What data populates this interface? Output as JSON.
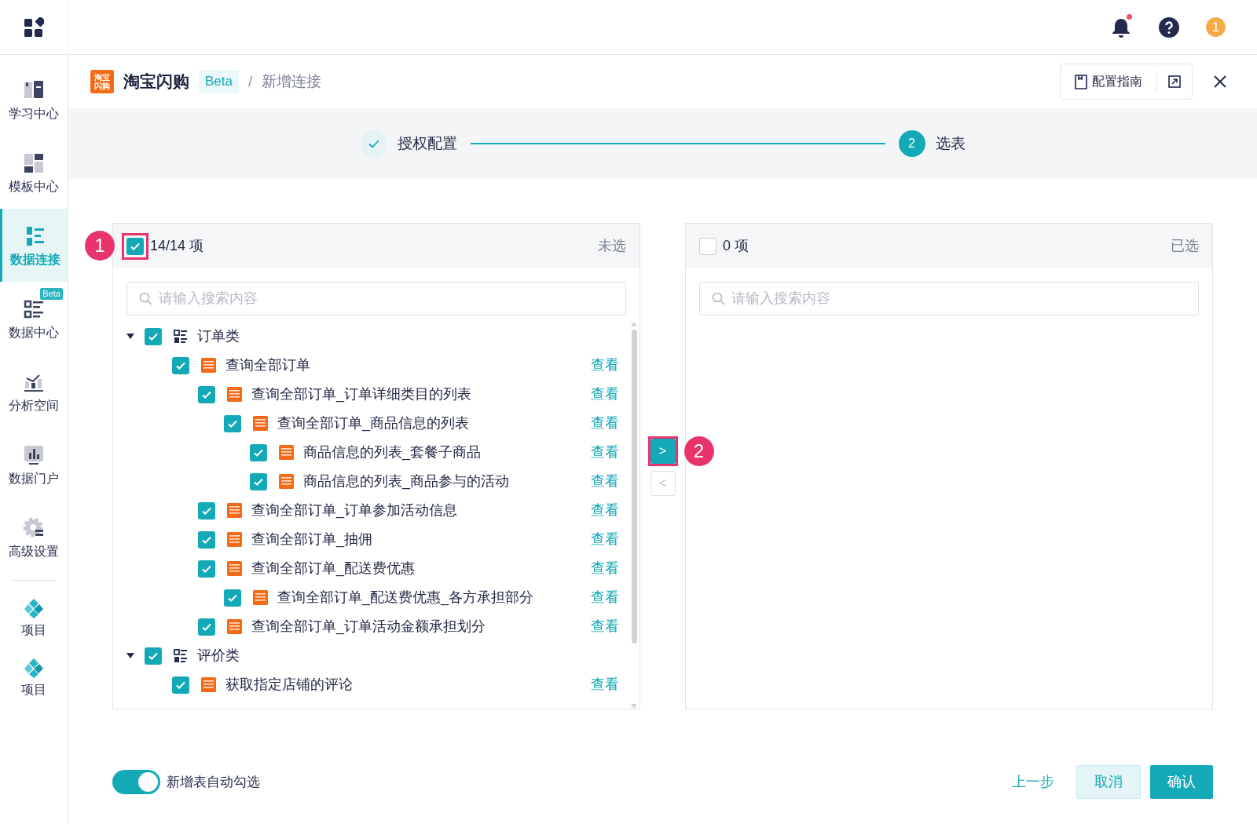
{
  "topbar": {
    "avatar_text": "1",
    "notification_dot": true
  },
  "sidebar": {
    "items": [
      {
        "label": "学习中心",
        "selected": false
      },
      {
        "label": "模板中心",
        "selected": false
      },
      {
        "label": "数据连接",
        "selected": true
      },
      {
        "label": "数据中心",
        "selected": false,
        "badge": "Beta"
      },
      {
        "label": "分析空间",
        "selected": false
      },
      {
        "label": "数据门户",
        "selected": false
      },
      {
        "label": "高级设置",
        "selected": false
      },
      {
        "label": "项目",
        "selected": false,
        "divider_before": true
      },
      {
        "label": "项目",
        "selected": false
      }
    ]
  },
  "header": {
    "logo_text": [
      "淘宝",
      "闪购"
    ],
    "title": "淘宝闪购",
    "badge": "Beta",
    "separator": "/",
    "breadcrumb": "新增连接",
    "guide_button": "配置指南"
  },
  "steps": [
    {
      "label": "授权配置",
      "kind": "done"
    },
    {
      "number": "2",
      "label": "选表",
      "kind": "active"
    }
  ],
  "source_panel": {
    "checked": true,
    "count": "14/14 项",
    "title": "未选",
    "search": {
      "placeholder": "请输入搜索内容"
    },
    "tree": [
      {
        "kind": "category",
        "label": "订单类",
        "checked": true,
        "expanded": true,
        "children": [
          {
            "kind": "table",
            "label": "查询全部订单",
            "checked": true,
            "action": "查看",
            "children": [
              {
                "kind": "table",
                "label": "查询全部订单_订单详细类目的列表",
                "checked": true,
                "action": "查看",
                "children": [
                  {
                    "kind": "table",
                    "label": "查询全部订单_商品信息的列表",
                    "checked": true,
                    "action": "查看",
                    "children": [
                      {
                        "kind": "table",
                        "label": "商品信息的列表_套餐子商品",
                        "checked": true,
                        "action": "查看"
                      },
                      {
                        "kind": "table",
                        "label": "商品信息的列表_商品参与的活动",
                        "checked": true,
                        "action": "查看"
                      }
                    ]
                  }
                ]
              },
              {
                "kind": "table",
                "label": "查询全部订单_订单参加活动信息",
                "checked": true,
                "action": "查看"
              },
              {
                "kind": "table",
                "label": "查询全部订单_抽佣",
                "checked": true,
                "action": "查看"
              },
              {
                "kind": "table",
                "label": "查询全部订单_配送费优惠",
                "checked": true,
                "action": "查看",
                "children": [
                  {
                    "kind": "table",
                    "label": "查询全部订单_配送费优惠_各方承担部分",
                    "checked": true,
                    "action": "查看"
                  }
                ]
              },
              {
                "kind": "table",
                "label": "查询全部订单_订单活动金额承担划分",
                "checked": true,
                "action": "查看"
              }
            ]
          }
        ]
      },
      {
        "kind": "category",
        "label": "评价类",
        "checked": true,
        "expanded": true,
        "children": [
          {
            "kind": "table",
            "label": "获取指定店铺的评论",
            "checked": true,
            "action": "查看"
          }
        ]
      }
    ]
  },
  "transfer_buttons": [
    {
      "label": ">",
      "disabled": false
    },
    {
      "label": "<",
      "disabled": true
    }
  ],
  "target_panel": {
    "checked": false,
    "count": "0 项",
    "title": "已选",
    "search": {
      "placeholder": "请输入搜索内容"
    }
  },
  "annotations": [
    {
      "label": "1"
    },
    {
      "label": "2"
    }
  ],
  "footer": {
    "toggle": {
      "label": "新增表自动勾选",
      "on": true
    },
    "buttons": [
      {
        "label": "上一步",
        "kind": "link"
      },
      {
        "label": "取消",
        "kind": "secondary"
      },
      {
        "label": "确认",
        "kind": "primary"
      }
    ]
  }
}
